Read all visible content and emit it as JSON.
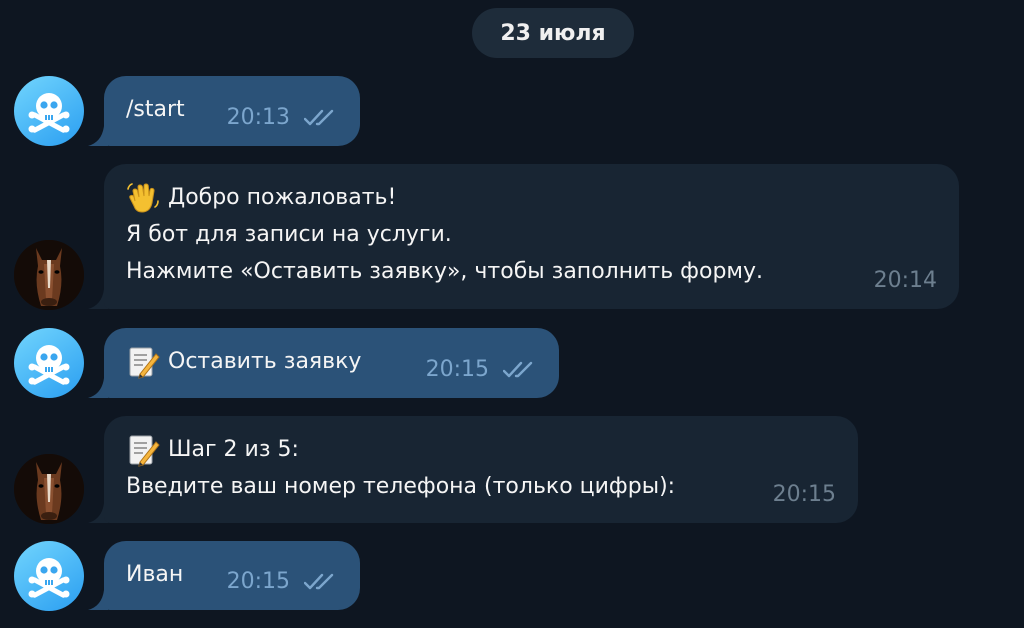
{
  "date_separator": "23 июля",
  "messages": [
    {
      "lines": [
        "/start"
      ],
      "time": "20:13"
    },
    {
      "lines": [
        "Добро пожаловать!",
        "Я бот для записи на услуги.",
        "Нажмите «Оставить заявку», чтобы заполнить форму."
      ],
      "time": "20:14",
      "emoji": "waving-hand"
    },
    {
      "lines": [
        "Оставить заявку"
      ],
      "time": "20:15",
      "emoji": "memo"
    },
    {
      "lines": [
        "Шаг 2 из 5:",
        "Введите ваш номер телефона (только цифры):"
      ],
      "time": "20:15",
      "emoji": "memo"
    },
    {
      "lines": [
        "Иван"
      ],
      "time": "20:15"
    }
  ],
  "colors": {
    "background": "#0e1621",
    "outgoing_bubble": "#2b5278",
    "incoming_bubble": "#182533",
    "date_pill": "#1e2c3a",
    "read_check": "#7ca6cd"
  }
}
